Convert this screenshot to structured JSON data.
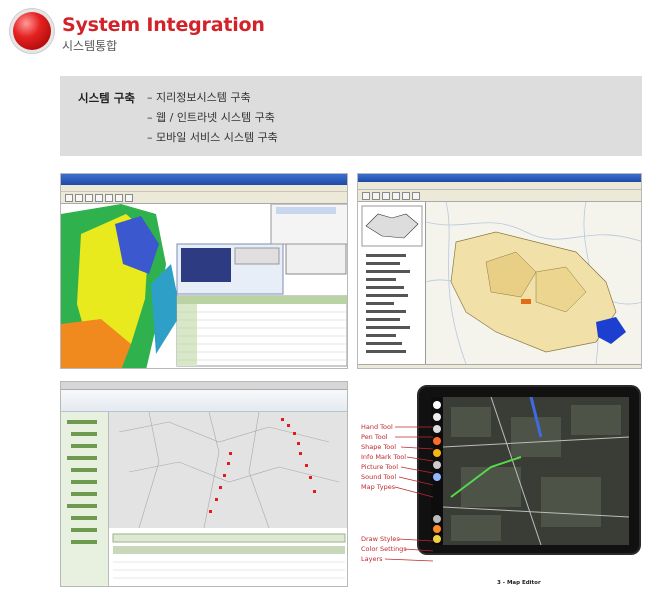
{
  "header": {
    "title": "System Integration",
    "subtitle": "시스템통합"
  },
  "info": {
    "label": "시스템 구축",
    "items": [
      "– 지리정보시스템 구축",
      "– 웹 / 인트라넷 시스템 구축",
      "– 모바일 서비스 시스템 구축"
    ]
  },
  "map_editor": {
    "tool_labels": [
      "Hand Tool",
      "Pen Tool",
      "Shape Tool",
      "Info Mark Tool",
      "Picture Tool",
      "Sound Tool",
      "Map Types"
    ],
    "bottom_labels": [
      "Draw Styles",
      "Color Settings",
      "Layers"
    ],
    "caption": "3 - Map Editor"
  },
  "colors": {
    "accent_red": "#d2232a",
    "info_box": "#dddddd",
    "label_red": "#c0282d"
  }
}
